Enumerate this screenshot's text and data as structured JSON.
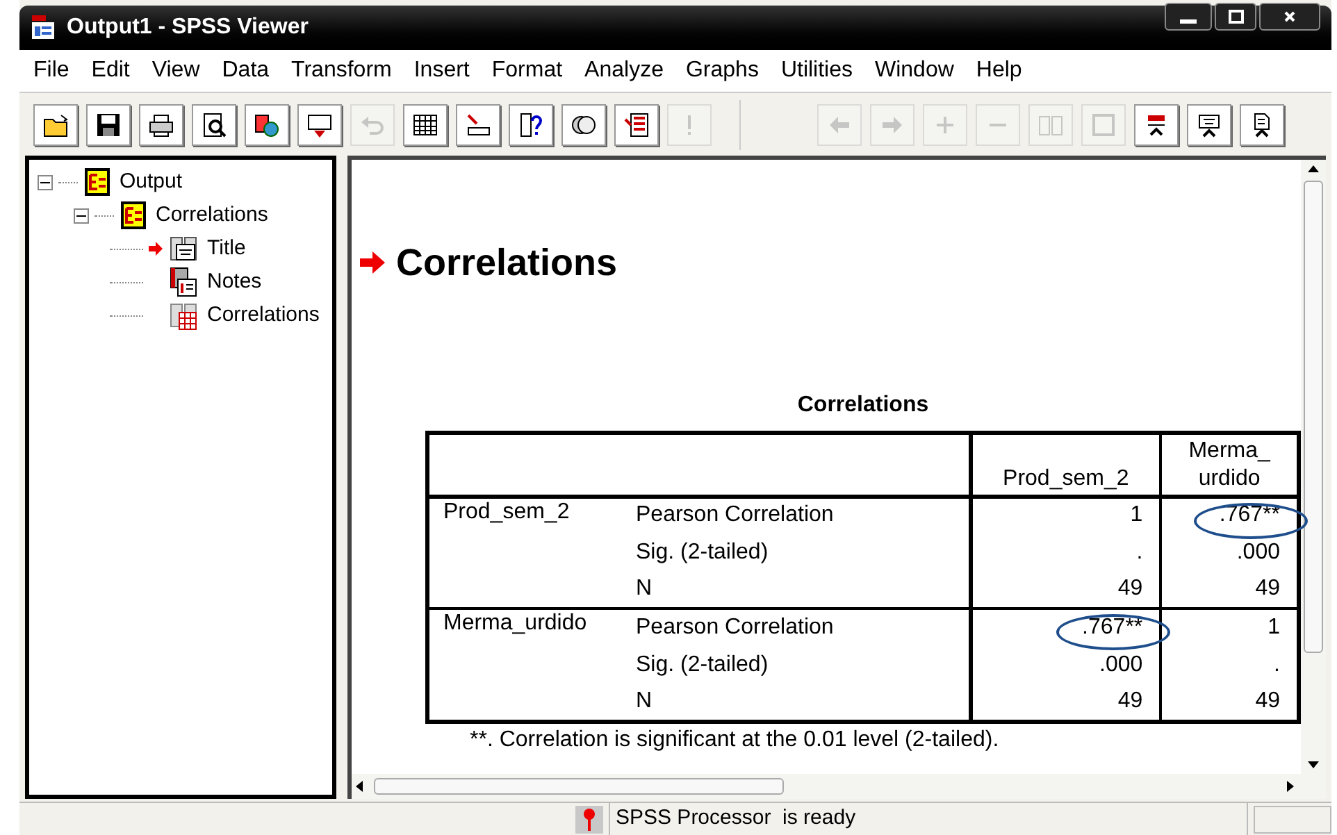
{
  "window": {
    "title": "Output1 - SPSS Viewer"
  },
  "menu": [
    "File",
    "Edit",
    "View",
    "Data",
    "Transform",
    "Insert",
    "Format",
    "Analyze",
    "Graphs",
    "Utilities",
    "Window",
    "Help"
  ],
  "toolbar": [
    {
      "kind": "open",
      "disabled": false
    },
    {
      "kind": "save",
      "disabled": false
    },
    {
      "kind": "print",
      "disabled": false
    },
    {
      "kind": "preview",
      "disabled": false
    },
    {
      "kind": "export",
      "disabled": false
    },
    {
      "kind": "dialog",
      "disabled": false
    },
    {
      "kind": "undo",
      "disabled": true
    },
    {
      "kind": "grid",
      "disabled": false
    },
    {
      "kind": "goto",
      "disabled": false
    },
    {
      "kind": "info",
      "disabled": false
    },
    {
      "kind": "sets",
      "disabled": false
    },
    {
      "kind": "designate",
      "disabled": false
    },
    {
      "kind": "run",
      "disabled": true
    },
    {
      "kind": "gap"
    },
    {
      "kind": "back",
      "disabled": true
    },
    {
      "kind": "forward",
      "disabled": true
    },
    {
      "kind": "expand",
      "disabled": true
    },
    {
      "kind": "collapse",
      "disabled": true
    },
    {
      "kind": "show",
      "disabled": true
    },
    {
      "kind": "hide",
      "disabled": true
    },
    {
      "kind": "heading",
      "disabled": false
    },
    {
      "kind": "title",
      "disabled": false
    },
    {
      "kind": "text",
      "disabled": false
    }
  ],
  "tree": [
    {
      "label": "Output",
      "kind": "book",
      "expanded": true,
      "children": [
        {
          "label": "Correlations",
          "kind": "book",
          "expanded": true,
          "children": [
            {
              "label": "Title",
              "kind": "title",
              "current": true
            },
            {
              "label": "Notes",
              "kind": "notes",
              "current": false
            },
            {
              "label": "Correlations",
              "kind": "table",
              "current": false
            }
          ]
        }
      ]
    }
  ],
  "output": {
    "heading": "Correlations",
    "table": {
      "title": "Correlations",
      "columns": [
        "Prod_sem_2",
        "Merma_ urdido"
      ],
      "groups": [
        {
          "variable": "Prod_sem_2",
          "rows": [
            {
              "statistic": "Pearson Correlation",
              "values": [
                {
                  "text": "1",
                  "circled": false
                },
                {
                  "text": ".767**",
                  "circled": true
                }
              ]
            },
            {
              "statistic": "Sig. (2-tailed)",
              "values": [
                {
                  "text": ".",
                  "circled": false
                },
                {
                  "text": ".000",
                  "circled": false
                }
              ]
            },
            {
              "statistic": "N",
              "values": [
                {
                  "text": "49",
                  "circled": false
                },
                {
                  "text": "49",
                  "circled": false
                }
              ]
            }
          ]
        },
        {
          "variable": "Merma_urdido",
          "rows": [
            {
              "statistic": "Pearson Correlation",
              "values": [
                {
                  "text": ".767**",
                  "circled": true
                },
                {
                  "text": "1",
                  "circled": false
                }
              ]
            },
            {
              "statistic": "Sig. (2-tailed)",
              "values": [
                {
                  "text": ".000",
                  "circled": false
                },
                {
                  "text": ".",
                  "circled": false
                }
              ]
            },
            {
              "statistic": "N",
              "values": [
                {
                  "text": "49",
                  "circled": false
                },
                {
                  "text": "49",
                  "circled": false
                }
              ]
            }
          ]
        }
      ],
      "footnote": "**. Correlation is significant at the 0.01 level (2-tailed)."
    }
  },
  "status_bar": {
    "message": "SPSS Processor  is ready"
  }
}
